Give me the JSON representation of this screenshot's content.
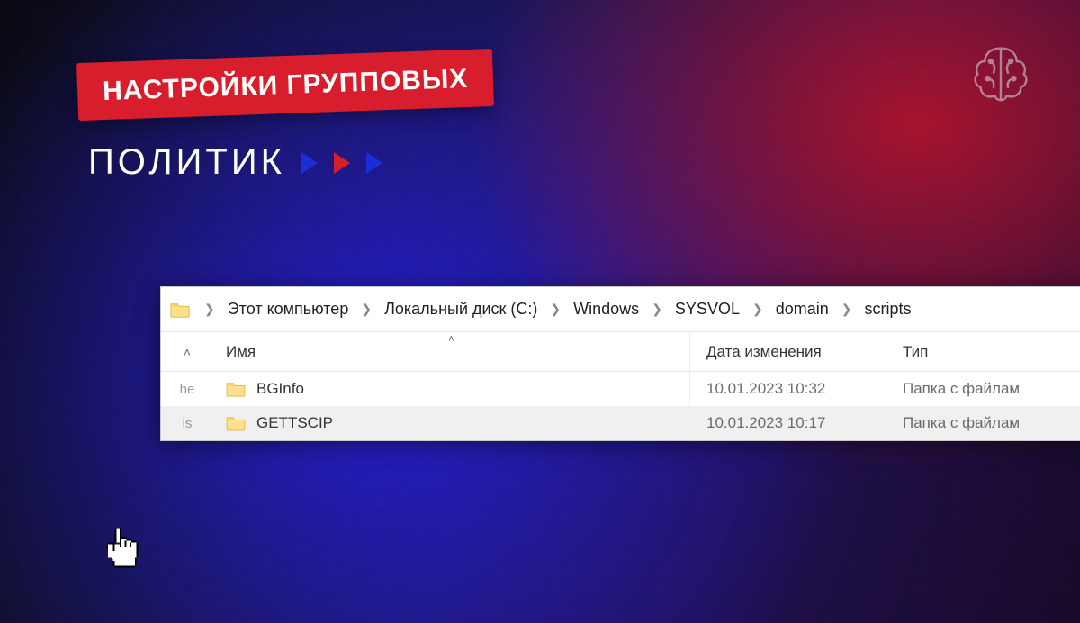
{
  "banner": {
    "text": "НАСТРОЙКИ ГРУППОВЫХ"
  },
  "subtitle": {
    "text": "ПОЛИТИК"
  },
  "breadcrumb": {
    "items": [
      "Этот компьютер",
      "Локальный диск (C:)",
      "Windows",
      "SYSVOL",
      "domain",
      "scripts"
    ]
  },
  "columns": {
    "name": "Имя",
    "date": "Дата изменения",
    "type": "Тип"
  },
  "nav_hints": [
    "he",
    "is"
  ],
  "rows": [
    {
      "name": "BGInfo",
      "date": "10.01.2023 10:32",
      "type": "Папка с файлам",
      "selected": false
    },
    {
      "name": "GETTSCIP",
      "date": "10.01.2023 10:17",
      "type": "Папка с файлам",
      "selected": true
    }
  ]
}
